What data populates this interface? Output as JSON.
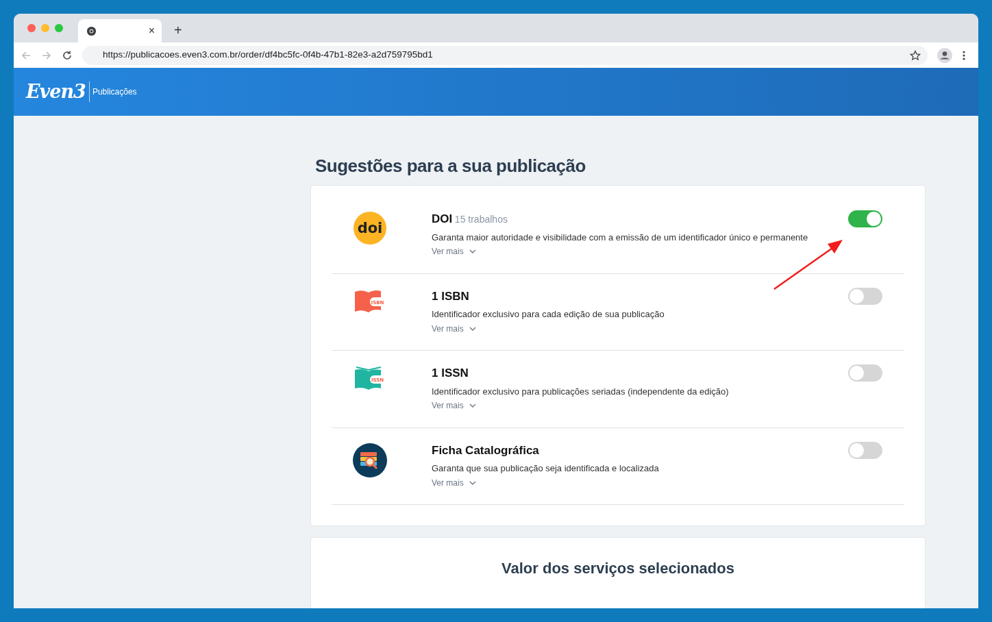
{
  "browser": {
    "url": "https://publicacoes.even3.com.br/order/df4bc5fc-0f4b-47b1-82e3-a2d759795bd1",
    "new_tab": "+",
    "close_tab": "×"
  },
  "header": {
    "logo": "Even3",
    "section": "Publicações"
  },
  "title": "Sugestões para a sua publicação",
  "services": [
    {
      "kind": "doi",
      "icon_text": "doi",
      "name": "DOI",
      "count": "15 trabalhos",
      "description": "Garanta maior autoridade e visibilidade com a emissão de um identificador único e permanente",
      "more": "Ver mais",
      "on": true
    },
    {
      "kind": "isbn",
      "icon_text": "ISBN",
      "name": "1 ISBN",
      "description": "Identificador exclusivo para cada edição de sua publicação",
      "more": "Ver mais",
      "on": false
    },
    {
      "kind": "issn",
      "icon_text": "ISSN",
      "name": "1 ISSN",
      "description": "Identificador exclusivo para publicações seriadas (independente da edição)",
      "more": "Ver mais",
      "on": false
    },
    {
      "kind": "catalog",
      "name": "Ficha Catalográfica",
      "description": "Garanta que sua publicação seja identificada e localizada",
      "more": "Ver mais",
      "on": false
    }
  ],
  "summary": {
    "title": "Valor dos serviços selecionados"
  }
}
